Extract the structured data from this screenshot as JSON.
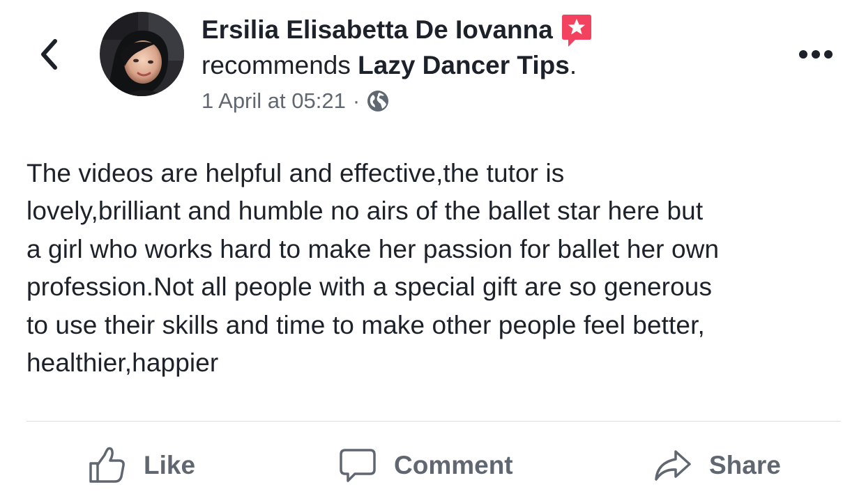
{
  "post": {
    "author": "Ersilia Elisabetta De Iovanna",
    "recommendation_verb": "recommends",
    "page_name": "Lazy Dancer Tips",
    "page_suffix": ".",
    "timestamp": "1 April at 05:21",
    "separator": "·",
    "privacy_icon": "globe-icon",
    "body": "The videos are helpful and effective,the tutor is\nlovely,brilliant and humble no airs of the ballet star here but\na girl who works hard to make her passion for ballet her own\nprofession.Not all people with a special gift are so generous\nto use their skills and time to make other people feel better,\nhealthier,happier"
  },
  "nav": {
    "back_icon": "chevron-left-icon",
    "more_icon": "more-horizontal-icon"
  },
  "actions": {
    "like": "Like",
    "comment": "Comment",
    "share": "Share"
  },
  "colors": {
    "text": "#1d2129",
    "secondary": "#606770",
    "recommend_badge": "#f3425f",
    "divider": "#dadde1"
  }
}
